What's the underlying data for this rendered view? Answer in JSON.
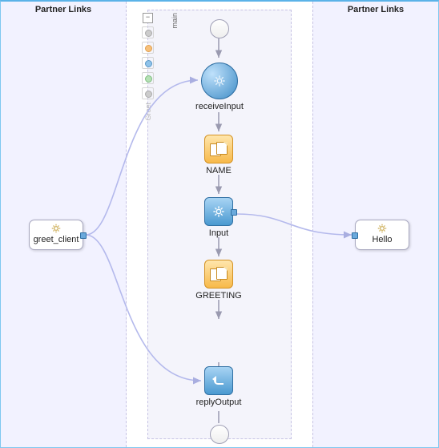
{
  "panels": {
    "left_title": "Partner Links",
    "right_title": "Partner Links"
  },
  "palette": {
    "main_label": "main",
    "greet_label": "Greet"
  },
  "partners": {
    "left": {
      "label": "greet_client"
    },
    "right": {
      "label": "Hello"
    }
  },
  "activities": {
    "receiveInput": {
      "label": "receiveInput"
    },
    "name": {
      "label": "NAME"
    },
    "input": {
      "label": "Input"
    },
    "greeting": {
      "label": "GREETING"
    },
    "replyOutput": {
      "label": "replyOutput"
    }
  },
  "chart_data": {
    "type": "diagram",
    "subtype": "bpel-process",
    "partner_links": [
      {
        "side": "left",
        "name": "greet_client"
      },
      {
        "side": "right",
        "name": "Hello"
      }
    ],
    "sequence": [
      {
        "id": "start",
        "kind": "start"
      },
      {
        "id": "receiveInput",
        "kind": "receive",
        "label": "receiveInput"
      },
      {
        "id": "NAME",
        "kind": "assign",
        "label": "NAME"
      },
      {
        "id": "Input",
        "kind": "invoke",
        "label": "Input"
      },
      {
        "id": "GREETING",
        "kind": "assign",
        "label": "GREETING"
      },
      {
        "id": "replyOutput",
        "kind": "reply",
        "label": "replyOutput"
      },
      {
        "id": "end",
        "kind": "end"
      }
    ],
    "links": [
      {
        "from": "greet_client",
        "to": "receiveInput"
      },
      {
        "from": "greet_client",
        "to": "replyOutput"
      },
      {
        "from": "Input",
        "to": "Hello"
      }
    ]
  }
}
